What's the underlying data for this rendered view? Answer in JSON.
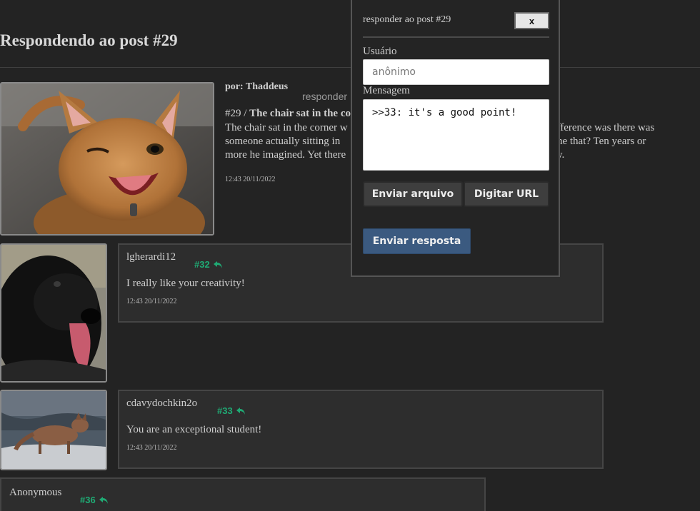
{
  "page": {
    "title": "Respondendo ao post #29"
  },
  "op": {
    "author": "por: Thaddeus",
    "reply_link": "responder",
    "number": "#29 /",
    "subject": "The chair sat in the co",
    "body_lines": [
      "The chair sat in the corner w                                                                           difference was there was",
      "someone actually sitting in                                                                               one that? Ten years or",
      "more he imagined. Yet there                                                                              w."
    ],
    "timestamp": "12:43 20/11/2022"
  },
  "replies": [
    {
      "name": "lgherardi12",
      "number": "#32",
      "message": "I really like your creativity!",
      "timestamp": "12:43 20/11/2022"
    },
    {
      "name": "cdavydochkin2o",
      "number": "#33",
      "message": "You are an exceptional student!",
      "timestamp": "12:43 20/11/2022"
    },
    {
      "name": "Anonymous",
      "number": "#36"
    }
  ],
  "modal": {
    "title": "responder ao post #29",
    "close_label": "x",
    "user_label": "Usuário",
    "user_placeholder": "anônimo",
    "message_label": "Mensagem",
    "message_value": ">>33: it's a good point!",
    "upload_button": "Enviar arquivo",
    "url_button": "Digitar URL",
    "send_button": "Enviar resposta"
  },
  "colors": {
    "accent_green": "#1faa74",
    "send_blue": "#3b5a80"
  }
}
